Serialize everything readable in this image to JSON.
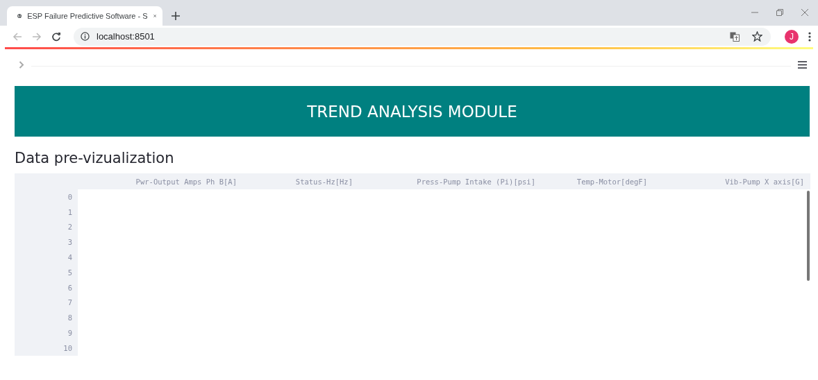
{
  "browser": {
    "tab_title": "ESP Failure Predictive Software - S",
    "address": "localhost:8501",
    "profile_initial": "J"
  },
  "banner": {
    "title": "TREND ANALYSIS MODULE"
  },
  "section": {
    "title": "Data pre-vizualization"
  },
  "table": {
    "columns": [
      "Pwr-Output Amps Ph B[A]",
      "Status-Hz[Hz]",
      "Press-Pump Intake (Pi)[psi]",
      "Temp-Motor[degF]",
      "Vib-Pump X axis[G]"
    ],
    "rows": [
      "0",
      "1",
      "2",
      "3",
      "4",
      "5",
      "6",
      "7",
      "8",
      "9",
      "10"
    ]
  }
}
